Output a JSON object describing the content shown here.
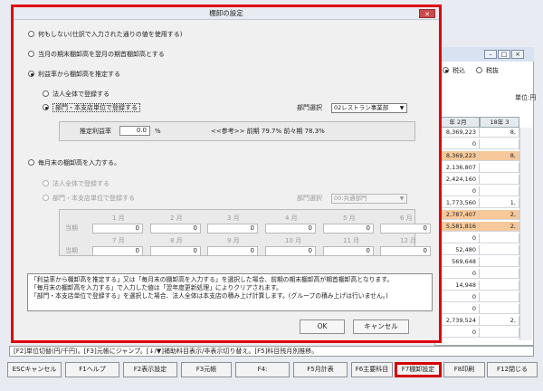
{
  "background": {
    "tax_options": [
      {
        "label": "税込",
        "selected": true
      },
      {
        "label": "税抜",
        "selected": false
      }
    ],
    "unit_label": "単位:円",
    "columns": [
      "年 2月",
      "18年 3"
    ],
    "col1": [
      "8,369,223",
      "0",
      "8,369,223",
      "2,136,807",
      "2,424,160",
      "0",
      "1,773,560",
      "2,787,407",
      "5,581,816",
      "0",
      "52,480",
      "569,648",
      "0",
      "14,948",
      "0",
      "0",
      "2,739,524",
      "0"
    ],
    "col2": [
      "8,",
      "",
      "8,",
      "",
      "",
      "",
      "1,",
      "2,",
      "2,",
      "",
      "",
      "",
      "",
      "",
      "",
      "",
      "2,",
      ""
    ],
    "highlight_rows": [
      2,
      7,
      8
    ],
    "hint": "[F2]単位切替(円/千円)。[F3]元帳にジャンプ。[↓/▼]補助科目表示/非表示切り替え。[F5]科目残月別推移。",
    "fkeys": [
      "ESCキャンセル",
      "F1ヘルプ",
      "F2表示設定",
      "F3元帳",
      "F4:",
      "F5月計表",
      "F6主要科目",
      "F7棚卸設定",
      "F8印刷",
      "F12閉じる"
    ],
    "active_fkey": "F7棚卸設定"
  },
  "dialog": {
    "title": "棚卸の設定",
    "close_label": "✕",
    "opt_none": "何もしない(仕訳で入力された通りの値を使用する)",
    "opt_prev": "当月の期末棚卸高を翌月の期首棚卸高とする",
    "opt_rate": "利益率から棚卸高を推定する",
    "sub_company": "法人全体で登録する",
    "sub_dept": "部門・本支店単位で登録する",
    "dept_label": "部門選択",
    "dept_value": "02レストラン事業部",
    "est_rate_label": "推定利益率",
    "est_rate_value": "0.0",
    "percent": "%",
    "ref_text": "<<参考>>  前期  79.7%    前々期  78.3%",
    "opt_monthly": "毎月末の棚卸高を入力する。",
    "sub2_company": "法人全体で登録する",
    "sub2_dept": "部門・本支店単位で登録する",
    "dept2_label": "部門選択",
    "dept2_value": "00:共通部門",
    "period_label": "当期",
    "months_row1": [
      "1 月",
      "2 月",
      "3 月",
      "4 月",
      "5 月",
      "6 月"
    ],
    "months_row2": [
      "7 月",
      "8 月",
      "9 月",
      "10 月",
      "11 月",
      "12 月"
    ],
    "month_values": [
      "0",
      "0",
      "0",
      "0",
      "0",
      "0",
      "0",
      "0",
      "0",
      "0",
      "0",
      "0"
    ],
    "info_lines": [
      "「利益率から棚卸高を推定する」又は「毎月末の棚卸高を入力する」を選択した場合、前期の期末棚卸高が期首棚卸高となります。",
      "「毎月末の棚卸高を入力する」で入力した値は「翌年度更新処理」によりクリアされます。",
      "「部門・本支店単位で登録する」を選択した場合、法人全体は本支店の積み上げ計算します。(グループの積み上げは行いません。)"
    ],
    "ok_label": "OK",
    "cancel_label": "キャンセル"
  }
}
